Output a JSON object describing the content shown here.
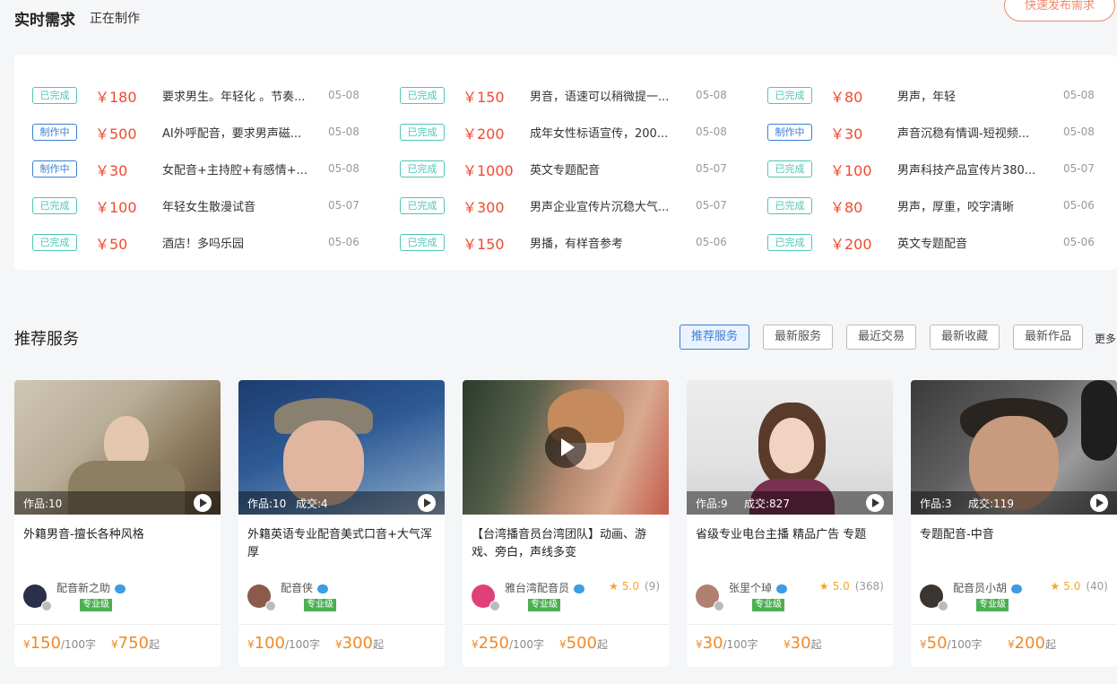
{
  "header": {
    "title": "实时需求",
    "subtitle": "正在制作",
    "publish_button": "快速发布需求"
  },
  "demands": [
    [
      {
        "status": "已完成",
        "type": "done",
        "price": "￥180",
        "desc": "要求男生。年轻化 。节奏...",
        "date": "05-08"
      },
      {
        "status": "制作中",
        "type": "making",
        "price": "￥500",
        "desc": "AI外呼配音，要求男声磁...",
        "date": "05-08"
      },
      {
        "status": "制作中",
        "type": "making",
        "price": "￥30",
        "desc": "女配音+主持腔+有感情+...",
        "date": "05-08"
      },
      {
        "status": "已完成",
        "type": "done",
        "price": "￥100",
        "desc": "年轻女生散漫试音",
        "date": "05-07"
      },
      {
        "status": "已完成",
        "type": "done",
        "price": "￥50",
        "desc": "酒店！多吗乐园",
        "date": "05-06"
      }
    ],
    [
      {
        "status": "已完成",
        "type": "done",
        "price": "￥150",
        "desc": "男音，语速可以稍微提一...",
        "date": "05-08"
      },
      {
        "status": "已完成",
        "type": "done",
        "price": "￥200",
        "desc": "成年女性标语宣传，200...",
        "date": "05-08"
      },
      {
        "status": "已完成",
        "type": "done",
        "price": "￥1000",
        "desc": "英文专题配音",
        "date": "05-07"
      },
      {
        "status": "已完成",
        "type": "done",
        "price": "￥300",
        "desc": "男声企业宣传片沉稳大气...",
        "date": "05-07"
      },
      {
        "status": "已完成",
        "type": "done",
        "price": "￥150",
        "desc": "男播，有样音参考",
        "date": "05-06"
      }
    ],
    [
      {
        "status": "已完成",
        "type": "done",
        "price": "￥80",
        "desc": "男声，年轻",
        "date": "05-08"
      },
      {
        "status": "制作中",
        "type": "making",
        "price": "￥30",
        "desc": "声音沉稳有情调-短视频...",
        "date": "05-08"
      },
      {
        "status": "已完成",
        "type": "done",
        "price": "￥100",
        "desc": "男声科技产品宣传片380...",
        "date": "05-07"
      },
      {
        "status": "已完成",
        "type": "done",
        "price": "￥80",
        "desc": "男声，厚重，咬字清晰",
        "date": "05-06"
      },
      {
        "status": "已完成",
        "type": "done",
        "price": "￥200",
        "desc": "英文专题配音",
        "date": "05-06"
      }
    ]
  ],
  "recommend": {
    "title": "推荐服务",
    "tabs": [
      "推荐服务",
      "最新服务",
      "最近交易",
      "最新收藏",
      "最新作品"
    ],
    "more": "更多"
  },
  "cards": [
    {
      "works": "作品:10",
      "deals": "",
      "title": "外籍男音-擅长各种风格",
      "seller": "配音新之助",
      "level": "专业级",
      "rating_score": "",
      "rating_count": "",
      "price": "150",
      "unit": "/100字",
      "start": "750",
      "start_word": "起",
      "yen": "¥"
    },
    {
      "works": "作品:10",
      "deals": "成交:4",
      "title": "外籍英语专业配音美式口音+大气浑厚",
      "seller": "配音侠",
      "level": "专业级",
      "rating_score": "",
      "rating_count": "",
      "price": "100",
      "unit": "/100字",
      "start": "300",
      "start_word": "起",
      "yen": "¥"
    },
    {
      "works": "",
      "deals": "",
      "title": "【台湾播音员台湾团队】动画、游戏、旁白，声线多变",
      "seller": "雅台湾配音员",
      "level": "专业级",
      "rating_score": "5.0",
      "rating_count": "(9)",
      "price": "250",
      "unit": "/100字",
      "start": "500",
      "start_word": "起",
      "yen": "¥"
    },
    {
      "works": "作品:9",
      "deals": "成交:827",
      "title": "省级专业电台主播 精品广告 专题",
      "seller": "张里个琸",
      "level": "专业级",
      "rating_score": "5.0",
      "rating_count": "(368)",
      "price": "30",
      "unit": "/100字",
      "start": "30",
      "start_word": "起",
      "yen": "¥"
    },
    {
      "works": "作品:3",
      "deals": "成交:119",
      "title": "专题配音-中音",
      "seller": "配音员小胡",
      "level": "专业级",
      "rating_score": "5.0",
      "rating_count": "(40)",
      "price": "50",
      "unit": "/100字",
      "start": "200",
      "start_word": "起",
      "yen": "¥"
    }
  ],
  "colors": {
    "done": "#4fc6b5",
    "making": "#3a7fd5",
    "price": "#f04a2f",
    "accent": "#f08a24"
  }
}
